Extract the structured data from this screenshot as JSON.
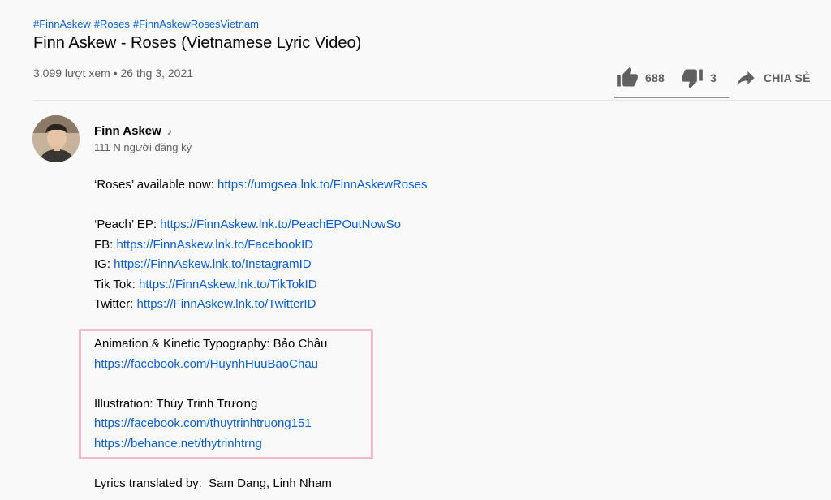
{
  "hashtags": [
    "#FinnAskew",
    "#Roses",
    "#FinnAskewRosesVietnam"
  ],
  "video": {
    "title": "Finn Askew - Roses (Vietnamese Lyric Video)",
    "views": "3.099 lượt xem",
    "separator": " • ",
    "date": "26 thg 3, 2021"
  },
  "actions": {
    "like_count": "688",
    "dislike_count": "3",
    "share_label": "CHIA SẺ",
    "like_ratio": 0.996
  },
  "channel": {
    "name": "Finn Askew",
    "verified_icon": "music-note-icon",
    "subscribers": "111 N người đăng ký"
  },
  "description": {
    "roses_label": "‘Roses’ available now: ",
    "roses_link": "https://umgsea.lnk.to/FinnAskewRoses",
    "peach_label": "‘Peach’ EP: ",
    "peach_link": "https://FinnAskew.lnk.to/PeachEPOutNowSo",
    "fb_label": "FB: ",
    "fb_link": "https://FinnAskew.lnk.to/FacebookID",
    "ig_label": "IG: ",
    "ig_link": "https://FinnAskew.lnk.to/InstagramID",
    "tiktok_label": "Tik Tok: ",
    "tiktok_link": "https://FinnAskew.lnk.to/TikTokID",
    "twitter_label": "Twitter: ",
    "twitter_link": "https://FinnAskew.lnk.to/TwitterID",
    "animation_credit": "Animation & Kinetic Typography: Bảo Châu",
    "animation_link": "https://facebook.com/HuynhHuuBaoChau",
    "illustration_credit": "Illustration: Thùy Trinh Trương",
    "illustration_link_1": "https://facebook.com/thuytrinhtruong151",
    "illustration_link_2": "https://behance.net/thytrinhtrng",
    "lyrics_credit": "Lyrics translated by:  Sam Dang, Linh Nham"
  },
  "colors": {
    "link": "#065fd4",
    "highlight_border": "#f5b8cd",
    "secondary_text": "#606060"
  }
}
